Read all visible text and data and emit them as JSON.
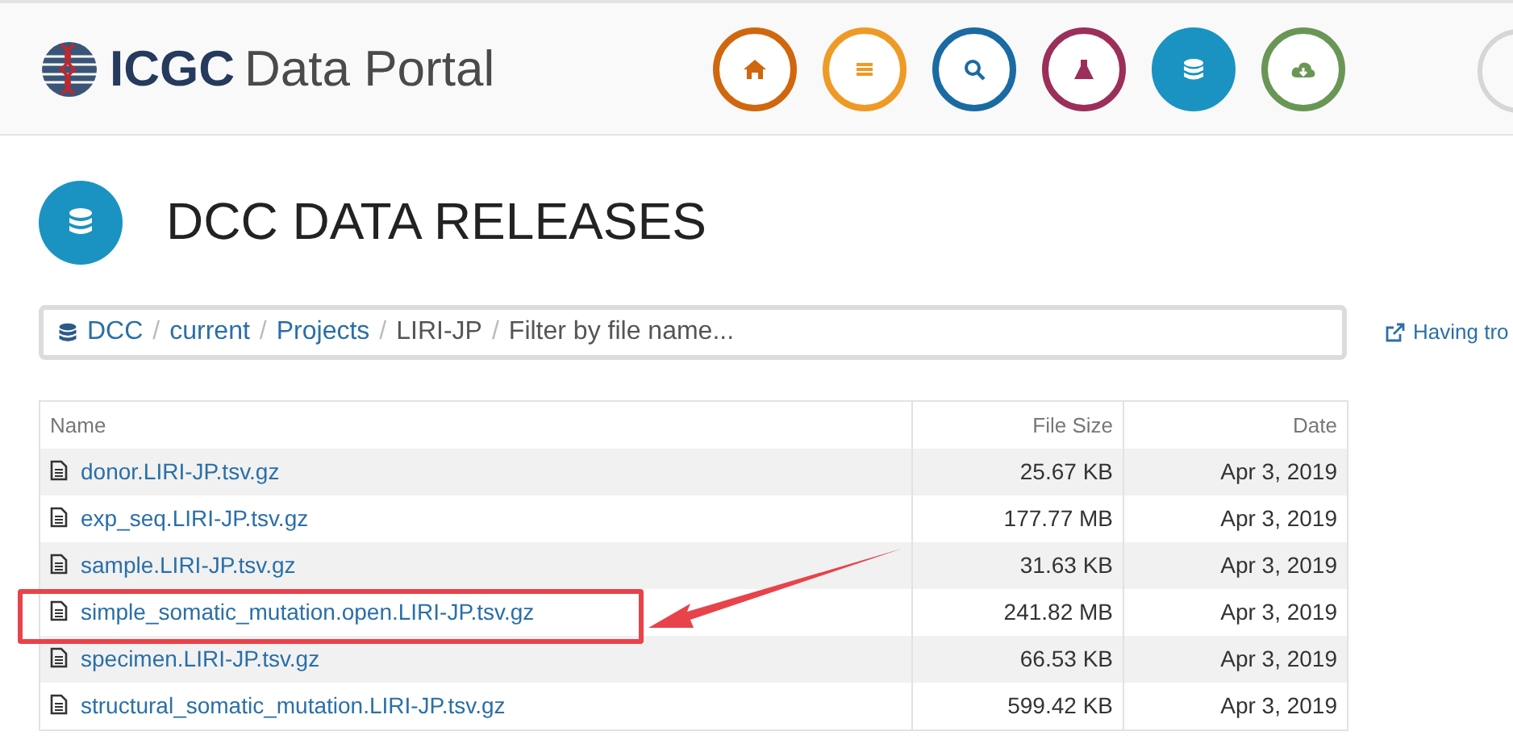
{
  "header": {
    "logo_bold": "ICGC",
    "logo_light": "Data Portal",
    "nav": [
      {
        "color": "#d0670e",
        "selected": false
      },
      {
        "color": "#ee9a25",
        "selected": false
      },
      {
        "color": "#1a6aa3",
        "selected": false
      },
      {
        "color": "#9b2f5a",
        "selected": false
      },
      {
        "color": "#1a93c2",
        "selected": true
      },
      {
        "color": "#6a9655",
        "selected": false
      }
    ]
  },
  "page_title": "DCC DATA RELEASES",
  "breadcrumb": {
    "items": [
      {
        "label": "DCC",
        "kind": "link"
      },
      {
        "label": "current",
        "kind": "link"
      },
      {
        "label": "Projects",
        "kind": "link"
      },
      {
        "label": "LIRI-JP",
        "kind": "current"
      }
    ],
    "separator": "/",
    "filter": {
      "placeholder": "Filter by file name..."
    }
  },
  "help_link": "Having tro",
  "table": {
    "columns": [
      "Name",
      "File Size",
      "Date"
    ],
    "rows": [
      {
        "name": "donor.LIRI-JP.tsv.gz",
        "size": "25.67 KB",
        "date": "Apr 3, 2019",
        "highlighted": false
      },
      {
        "name": "exp_seq.LIRI-JP.tsv.gz",
        "size": "177.77 MB",
        "date": "Apr 3, 2019",
        "highlighted": false
      },
      {
        "name": "sample.LIRI-JP.tsv.gz",
        "size": "31.63 KB",
        "date": "Apr 3, 2019",
        "highlighted": false
      },
      {
        "name": "simple_somatic_mutation.open.LIRI-JP.tsv.gz",
        "size": "241.82 MB",
        "date": "Apr 3, 2019",
        "highlighted": true
      },
      {
        "name": "specimen.LIRI-JP.tsv.gz",
        "size": "66.53 KB",
        "date": "Apr 3, 2019",
        "highlighted": false
      },
      {
        "name": "structural_somatic_mutation.LIRI-JP.tsv.gz",
        "size": "599.42 KB",
        "date": "Apr 3, 2019",
        "highlighted": false
      }
    ]
  }
}
